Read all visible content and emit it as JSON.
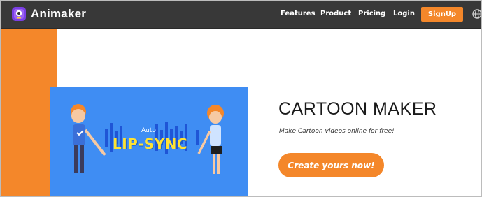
{
  "brand": {
    "name": "Animaker",
    "accent": "#f4872a",
    "nav_bg": "#383838",
    "video_bg": "#3f8df3"
  },
  "nav": {
    "links": [
      "Features",
      "Product",
      "Pricing",
      "Login"
    ],
    "signup_label": "SignUp",
    "language_icon": "globe-icon"
  },
  "hero": {
    "title": "CARTOON MAKER",
    "subtitle": "Make Cartoon videos online for free!",
    "cta_label": "Create yours now!",
    "video": {
      "small_text": "Auto",
      "big_text": "LIP-SYNC"
    }
  }
}
